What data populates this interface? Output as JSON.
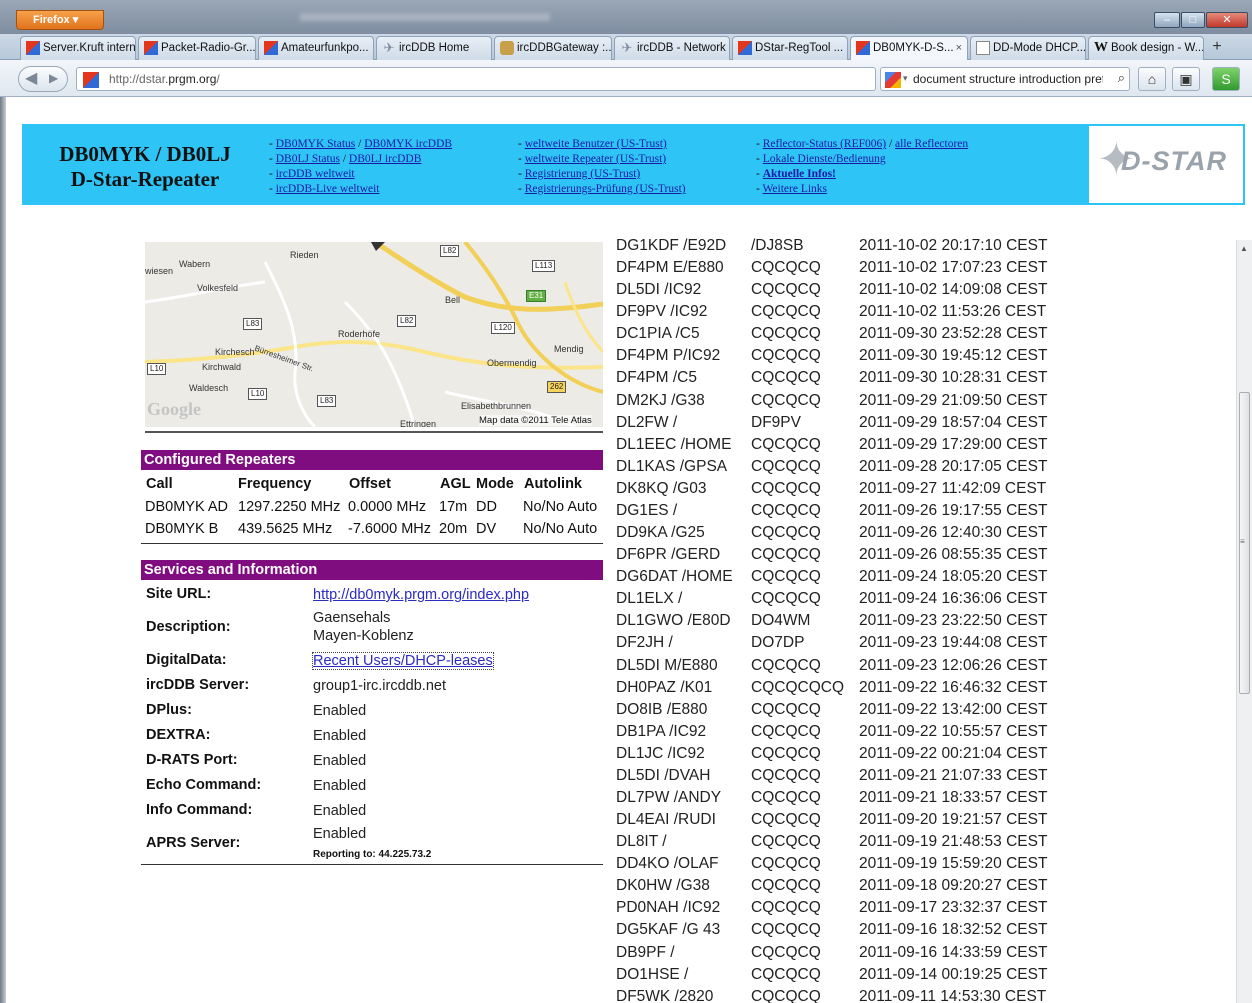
{
  "browser": {
    "menu_label": "Firefox ▾",
    "tabs": [
      {
        "label": "Server.Kruft intern",
        "icon": "dstar-favicon"
      },
      {
        "label": "Packet-Radio-Gr...",
        "icon": "dstar-favicon"
      },
      {
        "label": "Amateurfunkpo...",
        "icon": "dstar-favicon"
      },
      {
        "label": "ircDDB Home",
        "icon": "ircddb-favicon"
      },
      {
        "label": "ircDDBGateway :...",
        "icon": "gateway-favicon"
      },
      {
        "label": "ircDDB - Network",
        "icon": "ircddb-favicon"
      },
      {
        "label": "DStar-RegTool ...",
        "icon": "dstar-favicon"
      },
      {
        "label": "DB0MYK-D-S...",
        "icon": "dstar-favicon",
        "active": true
      },
      {
        "label": "DD-Mode DHCP...",
        "icon": "document-favicon"
      },
      {
        "label": "Book design - W...",
        "icon": "wikipedia-favicon"
      }
    ],
    "close_tab_glyph": "×",
    "new_tab_glyph": "+",
    "url_prefix": "http://dstar.",
    "url_host": "prgm.org",
    "url_suffix": "/",
    "search_text": "document structure introduction prefa"
  },
  "header": {
    "title_line1": "DB0MYK / DB0LJ",
    "title_line2": "D-Star-Repeater",
    "col1": {
      "r1a": "DB0MYK Status",
      "r1sep": " / ",
      "r1b": "DB0MYK ircDDB",
      "r2a": "DB0LJ Status",
      "r2sep": " / ",
      "r2b": "DB0LJ ircDDB",
      "r3": "ircDDB weltweit",
      "r4": "ircDDB-Live weltweit"
    },
    "col2": {
      "r1": "weltweite Benutzer (US-Trust)",
      "r2": "weltweite Repeater (US-Trust)",
      "r3": "Registrierung (US-Trust)",
      "r4": "Registrierungs-Prüfung (US-Trust)"
    },
    "col3": {
      "r1a": "Reflector-Status (REF006)",
      "r1sep": " / ",
      "r1b": "alle Reflectoren",
      "r2": "Lokale Dienste/Bedienung",
      "r3": "Aktuelle Infos!",
      "r4": "Weitere Links"
    },
    "list_dash": "- ",
    "logo_text": "D-STAR"
  },
  "map": {
    "labels": {
      "wabern": "Wabern",
      "rieden": "Rieden",
      "wiesen": "wiesen",
      "volkesfeld": "Volkesfeld",
      "bell": "Bell",
      "roderhoefe": "Roderhöfe",
      "kirchesch": "Kirchesch",
      "kirchwald": "Kirchwald",
      "waldesch": "Waldesch",
      "mendig": "Mendig",
      "obermendig": "Obermendig",
      "elisabethbrunnen": "Elisabethbrunnen",
      "ettringen": "Ettringen",
      "street": "Bürresheimer Str."
    },
    "roads": {
      "l82a": "L82",
      "l113": "L113",
      "e31": "E31",
      "l83a": "L83",
      "l82b": "L82",
      "l120": "L120",
      "l10": "L10",
      "l10b": "L10",
      "l83b": "L83",
      "r262": "262"
    },
    "google": "Google",
    "copyright": "Map data ©2011 Tele Atlas"
  },
  "repeaters": {
    "heading": "Configured Repeaters",
    "columns": {
      "call": "Call",
      "frequency": "Frequency",
      "offset": "Offset",
      "agl": "AGL",
      "mode": "Mode",
      "autolink": "Autolink"
    },
    "rows": [
      {
        "call": "DB0MYK AD",
        "frequency": "1297.2250 MHz",
        "offset": "0.0000 MHz",
        "agl": "17m",
        "mode": "DD",
        "autolink": "No/No Auto"
      },
      {
        "call": "DB0MYK B",
        "frequency": "439.5625 MHz",
        "offset": "-7.6000 MHz",
        "agl": "20m",
        "mode": "DV",
        "autolink": "No/No Auto"
      }
    ]
  },
  "services": {
    "heading": "Services and Information",
    "site_url_label": "Site URL:",
    "site_url": "http://db0myk.prgm.org/index.php",
    "description_label": "Description:",
    "description_line1": "Gaensehals",
    "description_line2": "Mayen-Koblenz",
    "digitaldata_label": "DigitalData:",
    "digitaldata": "Recent Users/DHCP-leases",
    "ircddb_label": "ircDDB Server:",
    "ircddb": "group1-irc.ircddb.net",
    "dplus_label": "DPlus:",
    "dplus": "Enabled",
    "dextra_label": "DEXTRA:",
    "dextra": "Enabled",
    "drats_label": "D-RATS Port:",
    "drats": "Enabled",
    "echo_label": "Echo Command:",
    "echo": "Enabled",
    "info_label": "Info Command:",
    "info": "Enabled",
    "aprs_label": "APRS Server:",
    "aprs": "Enabled",
    "aprs_reporting": "Reporting to: 44.225.73.2"
  },
  "users": [
    [
      "DG1KDF /E92D",
      "/DJ8SB",
      "2011-10-02 20:17:10 CEST"
    ],
    [
      "DF4PM E/E880",
      "CQCQCQ",
      "2011-10-02 17:07:23 CEST"
    ],
    [
      "DL5DI /IC92",
      "CQCQCQ",
      "2011-10-02 14:09:08 CEST"
    ],
    [
      "DF9PV /IC92",
      "CQCQCQ",
      "2011-10-02 11:53:26 CEST"
    ],
    [
      "DC1PIA /C5",
      "CQCQCQ",
      "2011-09-30 23:52:28 CEST"
    ],
    [
      "DF4PM P/IC92",
      "CQCQCQ",
      "2011-09-30 19:45:12 CEST"
    ],
    [
      "DF4PM /C5",
      "CQCQCQ",
      "2011-09-30 10:28:31 CEST"
    ],
    [
      "DM2KJ /G38",
      "CQCQCQ",
      "2011-09-29 21:09:50 CEST"
    ],
    [
      "DL2FW /",
      "DF9PV",
      "2011-09-29 18:57:04 CEST"
    ],
    [
      "DL1EEC /HOME",
      "CQCQCQ",
      "2011-09-29 17:29:00 CEST"
    ],
    [
      "DL1KAS /GPSA",
      "CQCQCQ",
      "2011-09-28 20:17:05 CEST"
    ],
    [
      "DK8KQ /G03",
      "CQCQCQ",
      "2011-09-27 11:42:09 CEST"
    ],
    [
      "DG1ES /",
      "CQCQCQ",
      "2011-09-26 19:17:55 CEST"
    ],
    [
      "DD9KA /G25",
      "CQCQCQ",
      "2011-09-26 12:40:30 CEST"
    ],
    [
      "DF6PR /GERD",
      "CQCQCQ",
      "2011-09-26 08:55:35 CEST"
    ],
    [
      "DG6DAT /HOME",
      "CQCQCQ",
      "2011-09-24 18:05:20 CEST"
    ],
    [
      "DL1ELX /",
      "CQCQCQ",
      "2011-09-24 16:36:06 CEST"
    ],
    [
      "DL1GWO /E80D",
      "DO4WM",
      "2011-09-23 23:22:50 CEST"
    ],
    [
      "DF2JH /",
      "DO7DP",
      "2011-09-23 19:44:08 CEST"
    ],
    [
      "DL5DI M/E880",
      "CQCQCQ",
      "2011-09-23 12:06:26 CEST"
    ],
    [
      "DH0PAZ /K01",
      "CQCQCQCQ",
      "2011-09-22 16:46:32 CEST"
    ],
    [
      "DO8IB /E880",
      "CQCQCQ",
      "2011-09-22 13:42:00 CEST"
    ],
    [
      "DB1PA /IC92",
      "CQCQCQ",
      "2011-09-22 10:55:57 CEST"
    ],
    [
      "DL1JC /IC92",
      "CQCQCQ",
      "2011-09-22 00:21:04 CEST"
    ],
    [
      "DL5DI /DVAH",
      "CQCQCQ",
      "2011-09-21 21:07:33 CEST"
    ],
    [
      "DL7PW /ANDY",
      "CQCQCQ",
      "2011-09-21 18:33:57 CEST"
    ],
    [
      "DL4EAI /RUDI",
      "CQCQCQ",
      "2011-09-20 19:21:57 CEST"
    ],
    [
      "DL8IT /",
      "CQCQCQ",
      "2011-09-19 21:48:53 CEST"
    ],
    [
      "DD4KO /OLAF",
      "CQCQCQ",
      "2011-09-19 15:59:20 CEST"
    ],
    [
      "DK0HW /G38",
      "CQCQCQ",
      "2011-09-18 09:20:27 CEST"
    ],
    [
      "PD0NAH /IC92",
      "CQCQCQ",
      "2011-09-17 23:32:37 CEST"
    ],
    [
      "DG5KAF /G 43",
      "CQCQCQ",
      "2011-09-16 18:32:52 CEST"
    ],
    [
      "DB9PF /",
      "CQCQCQ",
      "2011-09-16 14:33:59 CEST"
    ],
    [
      "DO1HSE /",
      "CQCQCQ",
      "2011-09-14 00:19:25 CEST"
    ],
    [
      "DF5WK /2820",
      "CQCQCQ",
      "2011-09-11 14:53:30 CEST"
    ]
  ],
  "colors": {
    "header_bg": "#2ec4f5",
    "section_bar": "#800d80",
    "link": "#1a1aa6"
  }
}
